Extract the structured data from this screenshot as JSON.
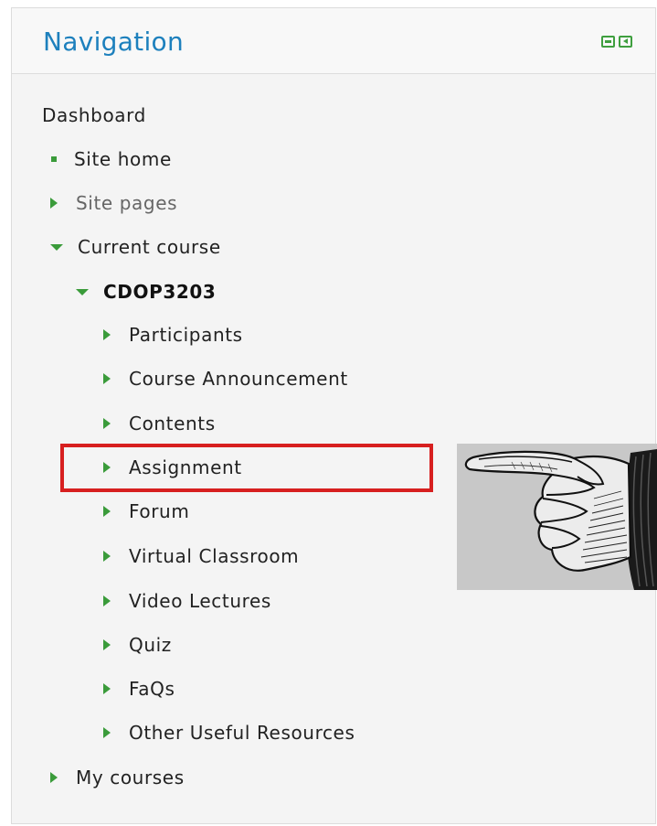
{
  "navigation": {
    "title": "Navigation",
    "controls": {
      "collapse_icon": "minus-box-icon",
      "dock_icon": "dock-left-icon"
    },
    "dashboard_label": "Dashboard",
    "site_home_label": "Site home",
    "site_pages_label": "Site pages",
    "current_course_label": "Current course",
    "course_code_label": "CDOP3203",
    "course_items": [
      {
        "label": "Participants"
      },
      {
        "label": "Course Announcement"
      },
      {
        "label": "Contents"
      },
      {
        "label": "Assignment"
      },
      {
        "label": "Forum"
      },
      {
        "label": "Virtual Classroom"
      },
      {
        "label": "Video Lectures"
      },
      {
        "label": "Quiz"
      },
      {
        "label": "FaQs"
      },
      {
        "label": "Other Useful Resources"
      }
    ],
    "my_courses_label": "My courses"
  },
  "annotations": {
    "highlight_target": "Assignment",
    "highlight_color": "#d71f1f",
    "pointer_image": "pointing-hand-illustration"
  },
  "colors": {
    "title_blue": "#1d80bd",
    "arrow_green": "#3a9b3a"
  }
}
